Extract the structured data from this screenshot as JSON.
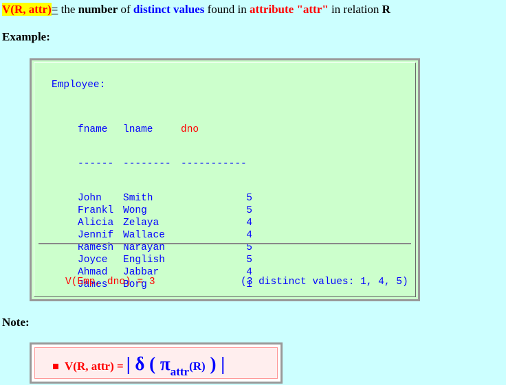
{
  "definition": {
    "term": "V(R, attr)",
    "eq": "=",
    "text1": " the ",
    "word_number": "number",
    "text2": " of ",
    "word_distinct": "distinct values",
    "text3": " found in ",
    "word_attribute": "attribute \"attr\"",
    "text4": " in relation ",
    "word_R": "R"
  },
  "example_heading": "Example:",
  "example": {
    "relation_name": "Employee:",
    "columns": [
      "fname",
      "lname",
      "dno"
    ],
    "dashes": [
      "------",
      "--------",
      "-----------"
    ],
    "rows": [
      [
        "John",
        "Smith",
        "5"
      ],
      [
        "Frankl",
        "Wong",
        "5"
      ],
      [
        "Alicia",
        "Zelaya",
        "4"
      ],
      [
        "Jennif",
        "Wallace",
        "4"
      ],
      [
        "Ramesh",
        "Narayan",
        "5"
      ],
      [
        "Joyce",
        "English",
        "5"
      ],
      [
        "Ahmad",
        "Jabbar",
        "4"
      ],
      [
        "James",
        "Borg",
        "1"
      ]
    ],
    "result_expr": "V(Emp, dno) = 3",
    "result_note": "(3 distinct values: 1, 4, 5)"
  },
  "note_heading": "Note:",
  "note": {
    "label": "V(R, attr) =",
    "bar_open": "|",
    "delta": " δ (",
    "pi": " π",
    "sub": "attr",
    "r": "(R)",
    "close": " ) ",
    "bar_close": "|"
  },
  "colors": {
    "background": "#ccffff",
    "box_bg": "#ccffcc",
    "highlight": "#ffff00",
    "red": "#ff0000",
    "blue": "#0000ff"
  }
}
